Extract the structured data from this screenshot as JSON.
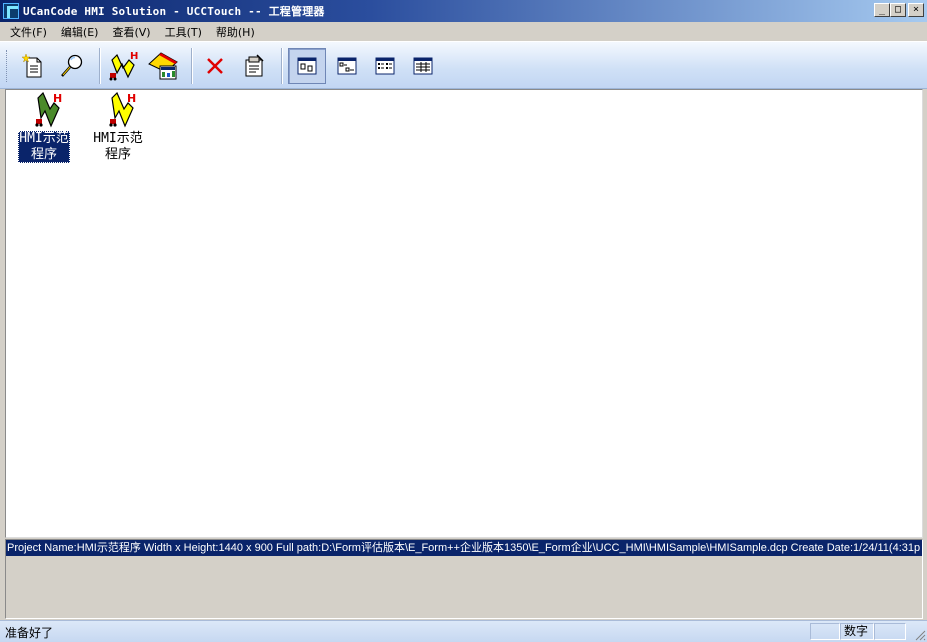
{
  "window": {
    "title": "UCanCode HMI Solution - UCCTouch -- 工程管理器",
    "minimize_glyph": "_",
    "maximize_glyph": "□",
    "close_glyph": "×"
  },
  "menu": [
    {
      "label": "文件(F)"
    },
    {
      "label": "编辑(E)"
    },
    {
      "label": "查看(V)"
    },
    {
      "label": "工具(T)"
    },
    {
      "label": "帮助(H)"
    }
  ],
  "toolbar": {
    "buttons": [
      {
        "name": "new-project",
        "icon": "new-document-icon"
      },
      {
        "name": "find",
        "icon": "magnifier-icon"
      },
      {
        "name": "open-hmi",
        "icon": "hmi-project-icon"
      },
      {
        "name": "run",
        "icon": "runtime-icon"
      },
      {
        "name": "delete",
        "icon": "delete-x-icon"
      },
      {
        "name": "properties",
        "icon": "properties-icon"
      },
      {
        "name": "view-large-icons",
        "icon": "large-icons-view-icon",
        "active": true
      },
      {
        "name": "view-small-icons",
        "icon": "small-icons-view-icon"
      },
      {
        "name": "view-list",
        "icon": "list-view-icon"
      },
      {
        "name": "view-details",
        "icon": "details-view-icon"
      }
    ]
  },
  "projects": [
    {
      "label": "HMI示范\n程序",
      "selected": true
    },
    {
      "label": "HMI示范\n程序",
      "selected": false
    }
  ],
  "info_line": "Project Name:HMI示范程序 Width x Height:1440 x 900 Full path:D:\\Form评估版本\\E_Form++企业版本1350\\E_Form企业\\UCC_HMI\\HMISample\\HMISample.dcp Create Date:1/24/11(4:31p",
  "status": {
    "text": "准备好了",
    "num_indicator": "数字"
  },
  "colors": {
    "selection": "#0a246a",
    "titlebar_start": "#0a246a",
    "toolbar_bg": "#cfe0f6"
  }
}
